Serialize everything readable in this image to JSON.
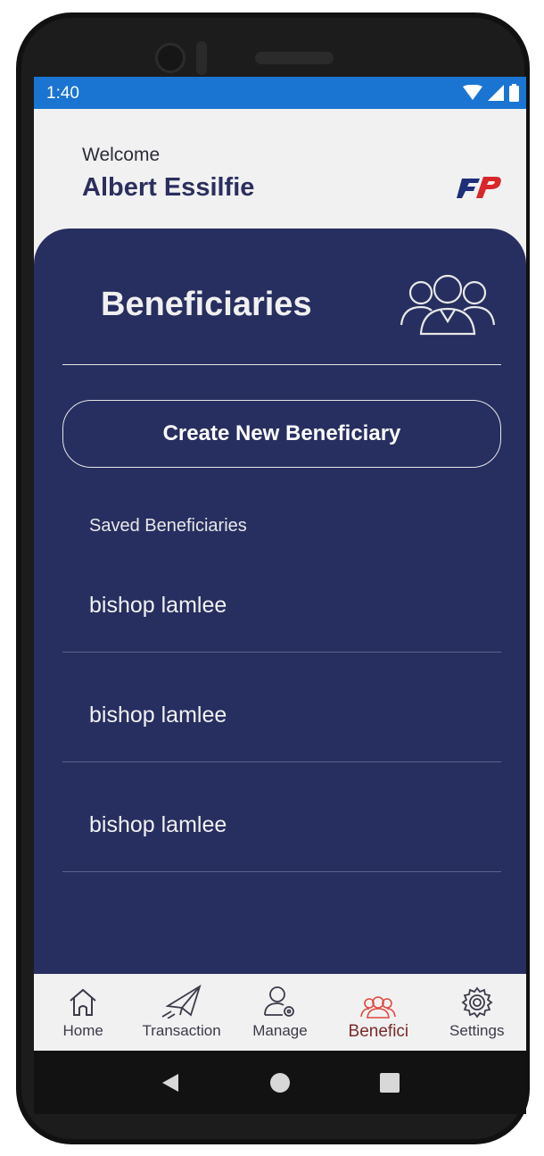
{
  "status_bar": {
    "time": "1:40"
  },
  "header": {
    "welcome": "Welcome",
    "user_name": "Albert Essilfie"
  },
  "panel": {
    "title": "Beneficiaries",
    "create_button": "Create New Beneficiary",
    "saved_label": "Saved Beneficiaries",
    "beneficiaries": [
      "bishop lamlee",
      "bishop lamlee",
      "bishop lamlee"
    ]
  },
  "bottom_nav": {
    "items": [
      {
        "label": "Home",
        "icon": "home-icon"
      },
      {
        "label": "Transaction",
        "icon": "paper-plane-icon"
      },
      {
        "label": "Manage",
        "icon": "user-settings-icon"
      },
      {
        "label": "Benefici",
        "icon": "group-icon",
        "active": true
      },
      {
        "label": "Settings",
        "icon": "gear-icon"
      }
    ]
  },
  "colors": {
    "status_bar": "#1a74d2",
    "panel": "#272f60",
    "active_nav": "#e0493f",
    "brand_red": "#d8262b",
    "brand_navy": "#1f2f7a"
  }
}
